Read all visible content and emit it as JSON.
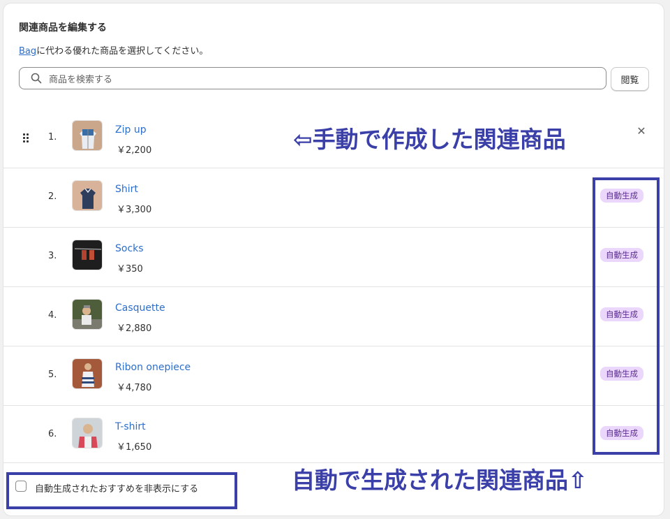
{
  "header": {
    "title": "関連商品を編集する",
    "subtitle_link": "Bag",
    "subtitle_rest": "に代わる優れた商品を選択してください。"
  },
  "search": {
    "placeholder": "商品を検索する",
    "browse_label": "閲覧"
  },
  "products": [
    {
      "index": "1.",
      "name": "Zip up",
      "price": "￥2,200"
    },
    {
      "index": "2.",
      "name": "Shirt",
      "price": "￥3,300",
      "badge": "自動生成"
    },
    {
      "index": "3.",
      "name": "Socks",
      "price": "￥350",
      "badge": "自動生成"
    },
    {
      "index": "4.",
      "name": "Casquette",
      "price": "￥2,880",
      "badge": "自動生成"
    },
    {
      "index": "5.",
      "name": "Ribon onepiece",
      "price": "￥4,780",
      "badge": "自動生成"
    },
    {
      "index": "6.",
      "name": "T-shirt",
      "price": "￥1,650",
      "badge": "自動生成"
    }
  ],
  "footer": {
    "checkbox_label": "自動生成されたおすすめを非表示にする",
    "checked": false
  },
  "annotations": {
    "manual": "⇦手動で作成した関連商品",
    "auto": "自動で生成された関連商品⇧"
  },
  "colors": {
    "link": "#2c6ecb",
    "badge_bg": "#ead7fb",
    "badge_text": "#5c2d91",
    "annotation": "#3b3fa8"
  }
}
